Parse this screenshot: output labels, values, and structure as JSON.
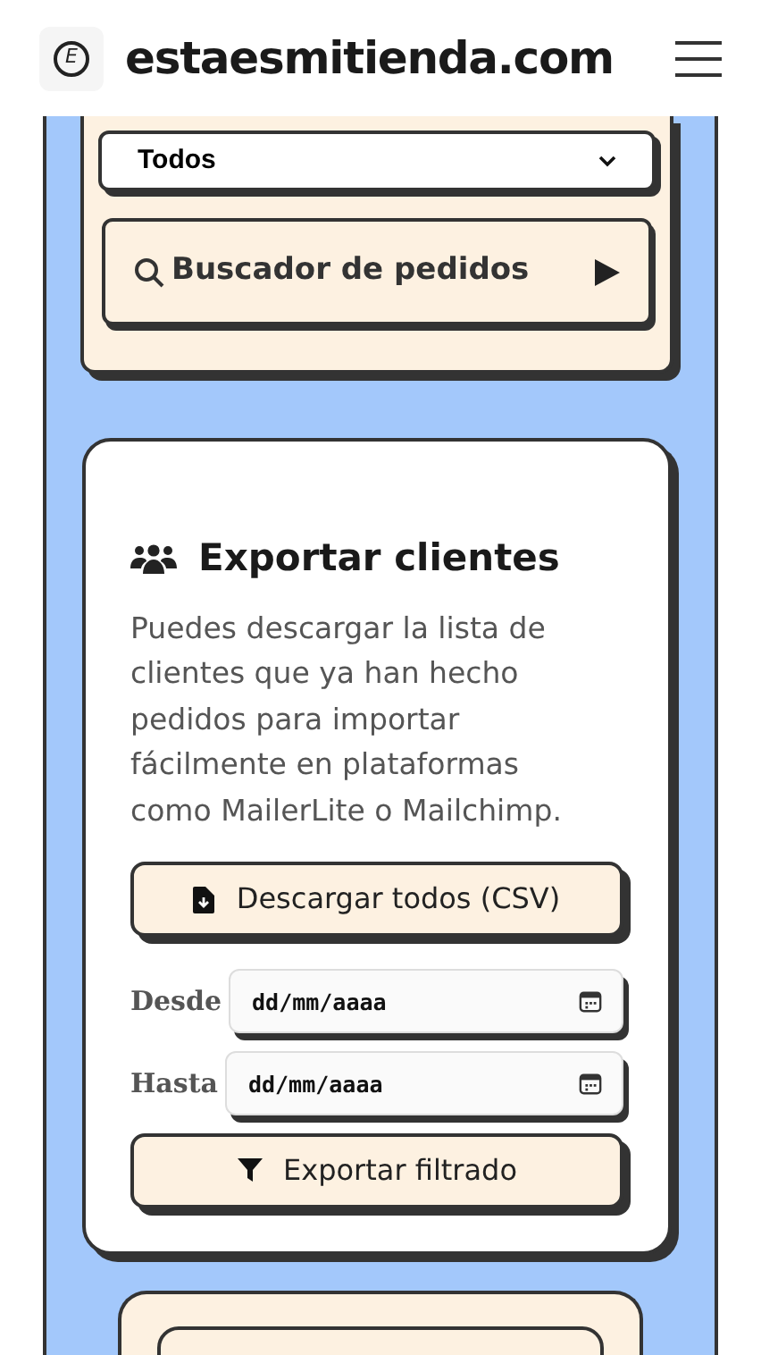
{
  "header": {
    "site_name": "estaesmitienda.com",
    "logo_letter": "E"
  },
  "orders_card": {
    "status_select": {
      "value": "Todos"
    },
    "search_button": {
      "label": "Buscador de pedidos",
      "expanded": false
    }
  },
  "export_card": {
    "title": "Exportar clientes",
    "description": "Puedes descargar la lista de clientes que ya han hecho pedidos para importar fácilmente en plataformas como MailerLite o Mailchimp.",
    "download_button": "Descargar todos (CSV)",
    "date_fields": [
      {
        "label": "Desde",
        "placeholder": "dd/mm/aaaa"
      },
      {
        "label": "Hasta",
        "placeholder": "dd/mm/aaaa"
      }
    ],
    "filter_button": "Exportar filtrado"
  }
}
